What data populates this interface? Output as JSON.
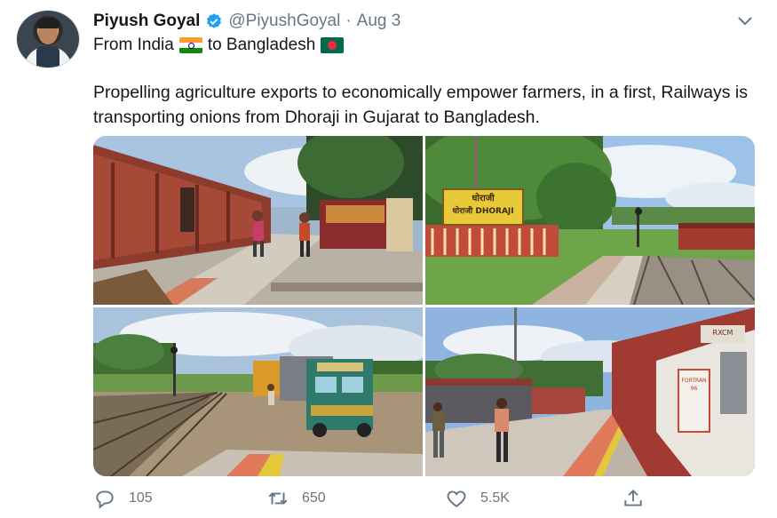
{
  "tweet": {
    "author_name": "Piyush Goyal",
    "handle": "@PiyushGoyal",
    "separator": "·",
    "date": "Aug 3",
    "subtitle_from": "From India",
    "subtitle_to": "to Bangladesh",
    "text": "Propelling agriculture exports to economically empower farmers, in a first, Railways is transporting onions from Dhoraji in Gujarat to Bangladesh.",
    "station_sign_1": "धोराजी",
    "station_sign_2": "धोराजी DHORAJI",
    "coach_marking": "RXCM",
    "coach_text": "FORTRAN 96"
  },
  "actions": {
    "reply_count": "105",
    "retweet_count": "650",
    "like_count": "5.5K"
  },
  "icons": {
    "verified": "verified-badge-icon",
    "more": "chevron-down-icon",
    "reply": "reply-icon",
    "retweet": "retweet-icon",
    "like": "heart-icon",
    "share": "share-icon"
  },
  "colors": {
    "verified_blue": "#1da1f2",
    "text_secondary": "#657786",
    "text_primary": "#14171a"
  }
}
